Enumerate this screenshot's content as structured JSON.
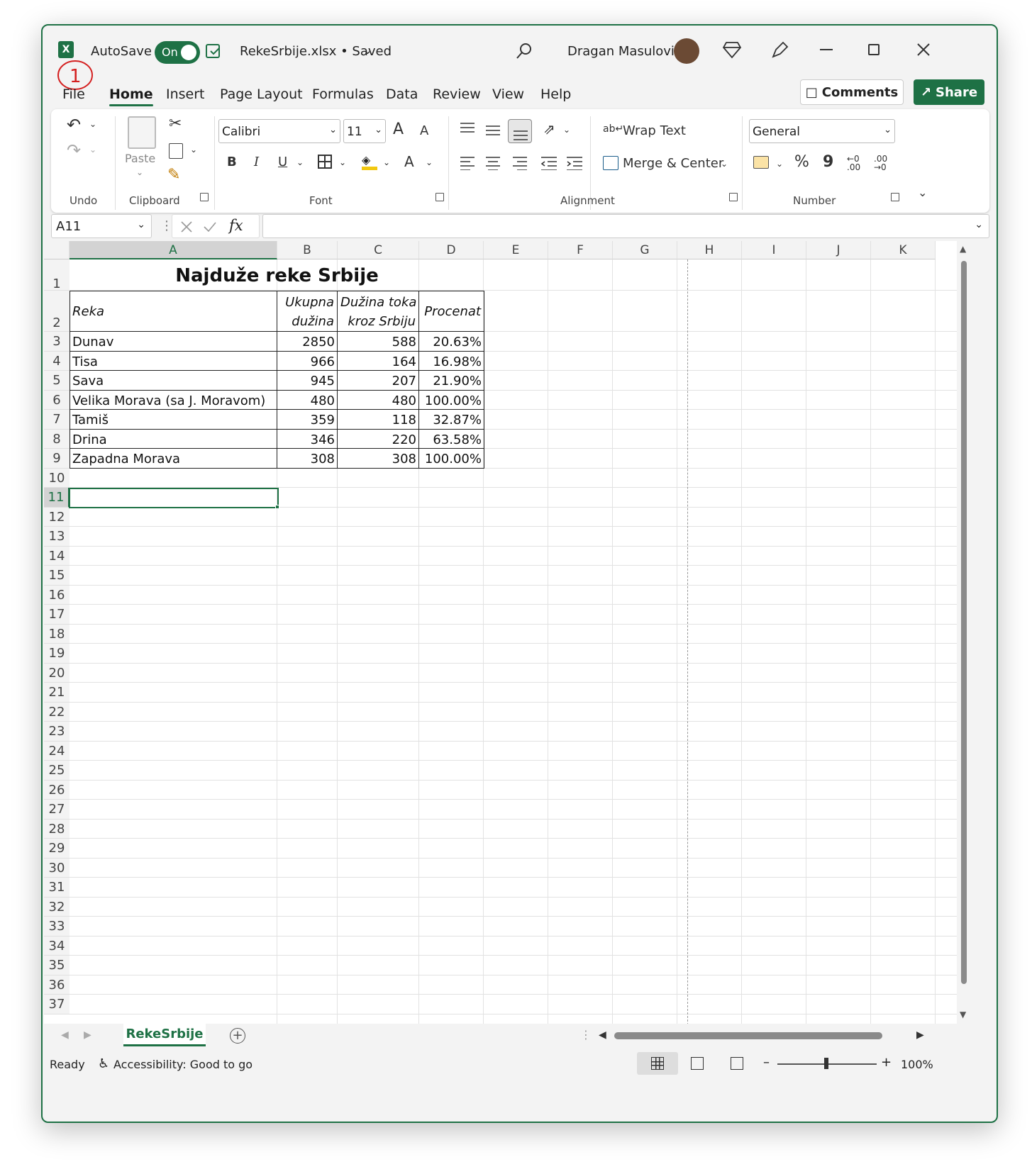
{
  "titlebar": {
    "autosave_label": "AutoSave",
    "autosave_state": "On",
    "filename": "RekeSrbije.xlsx • Saved",
    "user_name": "Dragan Masulovic",
    "annotation": "1"
  },
  "tabs": [
    {
      "label": "File"
    },
    {
      "label": "Home"
    },
    {
      "label": "Insert"
    },
    {
      "label": "Page Layout"
    },
    {
      "label": "Formulas"
    },
    {
      "label": "Data"
    },
    {
      "label": "Review"
    },
    {
      "label": "View"
    },
    {
      "label": "Help"
    }
  ],
  "actions": {
    "comments": "Comments",
    "share": "Share"
  },
  "ribbon": {
    "groups": {
      "undo": "Undo",
      "clipboard": "Clipboard",
      "font": "Font",
      "alignment": "Alignment",
      "number": "Number"
    },
    "paste_label": "Paste",
    "font_name": "Calibri",
    "font_size": "11",
    "wrap_text": "Wrap Text",
    "merge_center": "Merge & Center",
    "number_format": "General",
    "bold": "B",
    "italic": "I",
    "underline": "U",
    "font_color": "A",
    "grow_font": "A",
    "shrink_font": "A",
    "percent": "%",
    "comma": "9",
    "inc_decimal": "←0 .00",
    "dec_decimal": ".00 →0"
  },
  "formula_bar": {
    "name_box": "A11",
    "formula": ""
  },
  "columns": [
    "A",
    "B",
    "C",
    "D",
    "E",
    "F",
    "G",
    "H",
    "I",
    "J",
    "K"
  ],
  "sheet": {
    "title": "Najduže reke Srbije",
    "headers": {
      "a": "Reka",
      "b1": "Ukupna",
      "b2": "dužina",
      "c1": "Dužina toka",
      "c2": "kroz Srbiju",
      "d": "Procenat"
    },
    "rows": [
      {
        "reka": "Dunav",
        "ukupna": "2850",
        "srbija": "588",
        "procenat": "20.63%"
      },
      {
        "reka": "Tisa",
        "ukupna": "966",
        "srbija": "164",
        "procenat": "16.98%"
      },
      {
        "reka": "Sava",
        "ukupna": "945",
        "srbija": "207",
        "procenat": "21.90%"
      },
      {
        "reka": "Velika Morava (sa J. Moravom)",
        "ukupna": "480",
        "srbija": "480",
        "procenat": "100.00%"
      },
      {
        "reka": "Tamiš",
        "ukupna": "359",
        "srbija": "118",
        "procenat": "32.87%"
      },
      {
        "reka": "Drina",
        "ukupna": "346",
        "srbija": "220",
        "procenat": "63.58%"
      },
      {
        "reka": "Zapadna Morava",
        "ukupna": "308",
        "srbija": "308",
        "procenat": "100.00%"
      }
    ]
  },
  "sheet_tab": "RekeSrbije",
  "status": {
    "ready": "Ready",
    "accessibility": "Accessibility: Good to go",
    "zoom": "100%"
  },
  "colors": {
    "accent": "#1e7145",
    "annotation": "#d42020"
  }
}
